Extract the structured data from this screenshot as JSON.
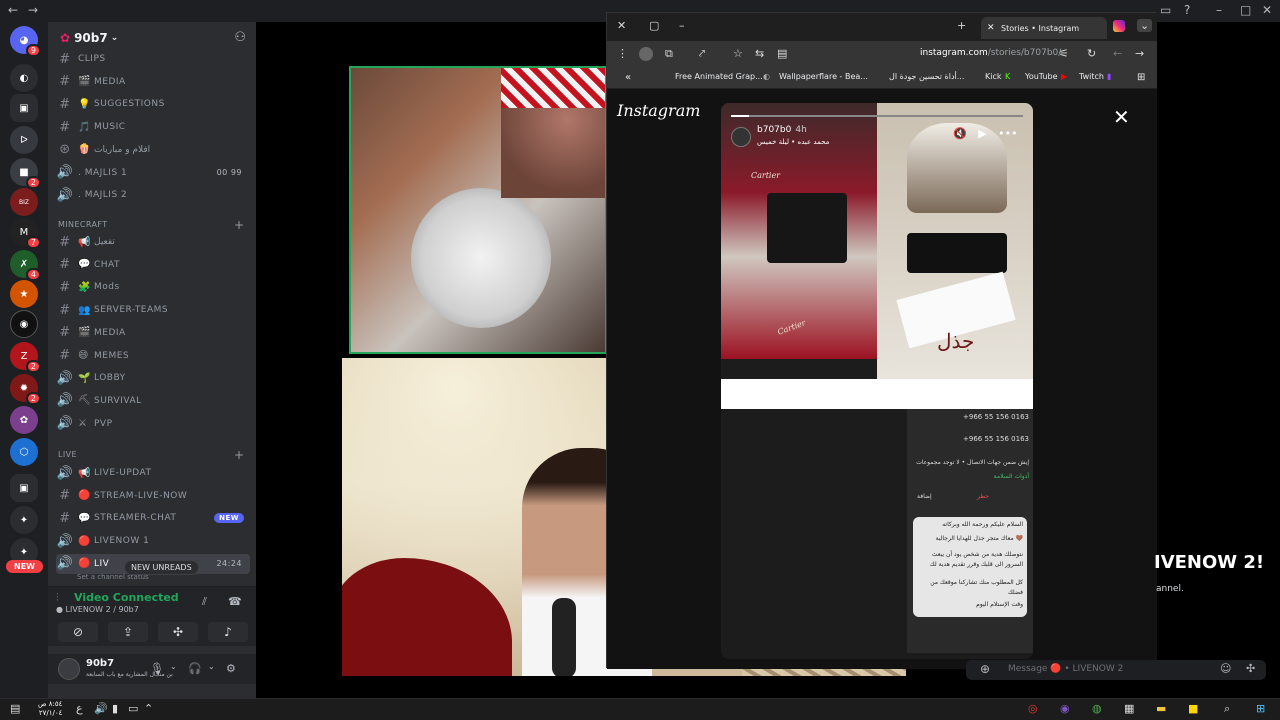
{
  "server": {
    "name": "90b7",
    "invite_icon": "add-member-icon"
  },
  "rail_badges": [
    "9",
    "2",
    "7",
    "4",
    "2",
    "2",
    "2"
  ],
  "channels": {
    "top": [
      {
        "icon": "#",
        "emoji": "",
        "label": "CLIPS",
        "extra": ""
      },
      {
        "icon": "#",
        "emoji": "🎬",
        "label": "MEDIA",
        "extra": ""
      },
      {
        "icon": "#",
        "emoji": "💡",
        "label": "SUGGESTIONS",
        "extra": ""
      },
      {
        "icon": "#",
        "emoji": "🎵",
        "label": "MUSIC",
        "extra": ""
      },
      {
        "icon": "⊛",
        "emoji": "🍿",
        "label": "افلام و مباريات",
        "extra": ""
      },
      {
        "icon": "🔊",
        "emoji": "",
        "label": ". MAJLIS 1",
        "extra": "00  99"
      },
      {
        "icon": "🔊",
        "emoji": "",
        "label": ". MAJLIS 2",
        "extra": ""
      }
    ],
    "minecraft_category": "MINECRAFT",
    "minecraft": [
      {
        "icon": "#",
        "emoji": "📢",
        "label": "تفعيل",
        "extra": ""
      },
      {
        "icon": "#",
        "emoji": "💬",
        "label": "CHAT",
        "extra": ""
      },
      {
        "icon": "#",
        "emoji": "🧩",
        "label": "Mods",
        "extra": ""
      },
      {
        "icon": "#",
        "emoji": "👥",
        "label": "SERVER-TEAMS",
        "extra": ""
      },
      {
        "icon": "#",
        "emoji": "🎬",
        "label": "MEDIA",
        "extra": ""
      },
      {
        "icon": "#",
        "emoji": "😄",
        "label": "MEMES",
        "extra": ""
      },
      {
        "icon": "🔊",
        "emoji": "🌱",
        "label": "LOBBY",
        "extra": ""
      },
      {
        "icon": "🔊",
        "emoji": "⛏",
        "label": "SURVIVAL",
        "extra": ""
      },
      {
        "icon": "🔊",
        "emoji": "⚔",
        "label": "PVP",
        "extra": ""
      }
    ],
    "live_category": "LIVE",
    "live": [
      {
        "icon": "🔊",
        "emoji": "📢",
        "label": "LIVE-UPDAT",
        "extra": ""
      },
      {
        "icon": "#",
        "emoji": "🔴",
        "label": "STREAM-LIVE-NOW",
        "extra": ""
      },
      {
        "icon": "#",
        "emoji": "💬",
        "label": "STREAMER-CHAT",
        "extra": "NEW"
      },
      {
        "icon": "🔊",
        "emoji": "🔴",
        "label": "LIVENOW 1",
        "extra": ""
      },
      {
        "icon": "🔊",
        "emoji": "🔴",
        "label": "LIV",
        "extra": "24:24"
      }
    ],
    "set_status": "Set a channel status"
  },
  "new_unreads": "NEW UNREADS",
  "new_left": "NEW",
  "voice": {
    "title": "Video Connected",
    "sub": "● LIVENOW 2 / 90b7"
  },
  "user": {
    "name": "90b7",
    "status": "بن منحال المشارية مع باب السابعة"
  },
  "browser": {
    "tab_title": "Stories • Instagram",
    "url_host": "instagram.com",
    "url_path": "/stories/b707b0/",
    "bookmarks": [
      "Free Animated Grap...",
      "Wallpaperflare - Bea...",
      "أداة تحسين جودة ال...",
      "Kick",
      "YouTube",
      "Twitch"
    ]
  },
  "instagram": {
    "logo": "Instagram",
    "story_user": "b707b0",
    "story_time": "4h",
    "story_song": "محمد عبده • ليلة خميس",
    "progress": 0.06,
    "img1_brand": "Cartier",
    "img2_text": "جذل",
    "phone_number": "+966 55 156 0163",
    "phone_lines": [
      "+966 55 156 0163",
      "إيش ضمن جهات الاتصال • لا توجد مجموعات",
      "أدوات السلامة"
    ],
    "phone_actions": [
      "إضافة",
      "حظر"
    ],
    "bubble": [
      "السلام عليكم ورحمة الله وبركاته",
      "معاك متجر جذل للهدايا الرجالية 🤎",
      "نتوصلك هدية من شخص يود أن يبعث",
      "السرور الى قلبك وقرر تقديم هدية لك",
      "كل المطلوب منك تشاركنا موقعك من",
      "فضلك",
      "وقت الإستلام اليوم"
    ]
  },
  "chat_bg": {
    "livenow": "IVENOW 2!",
    "annel": "annel.",
    "message_placeholder": "Message 🔴 • LIVENOW 2"
  },
  "taskbar": {
    "clock_time": "٨:٥٤ ص",
    "clock_date": "٢٧/١/٠٤"
  }
}
